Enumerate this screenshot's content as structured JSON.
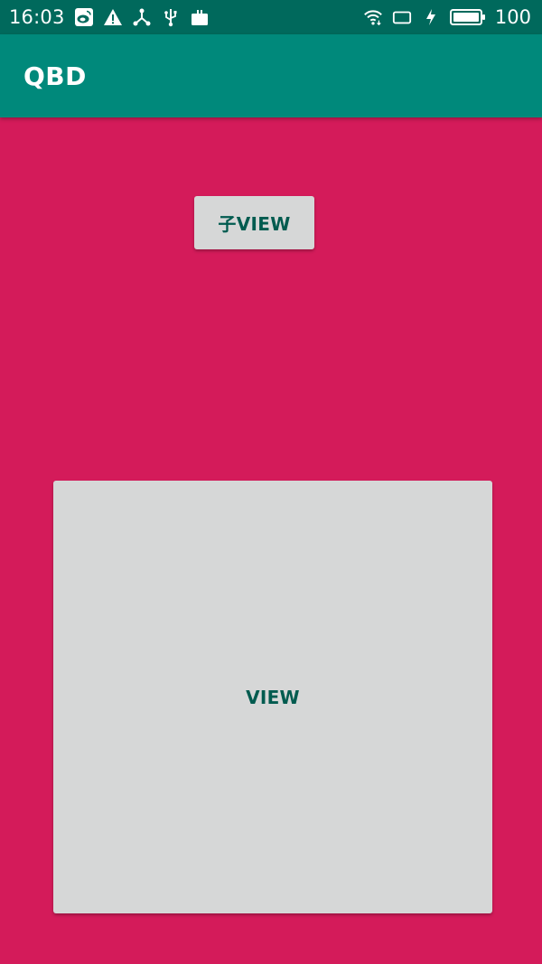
{
  "status_bar": {
    "time": "16:03",
    "battery_level": "100",
    "icons_left": [
      "weibo-icon",
      "warning-icon",
      "share-icon",
      "usb-icon",
      "briefcase-icon"
    ],
    "icons_right": [
      "wifi-icon",
      "rotate-icon",
      "charging-bolt-icon",
      "battery-icon"
    ]
  },
  "app_bar": {
    "title": "QBD"
  },
  "buttons": {
    "child_view_label": "子VIEW",
    "view_label": "VIEW"
  },
  "colors": {
    "status_bar": "#00695c",
    "app_bar": "#00897b",
    "background": "#d41b5a",
    "button_bg": "#d6d7d7",
    "button_text": "#005b4f"
  }
}
